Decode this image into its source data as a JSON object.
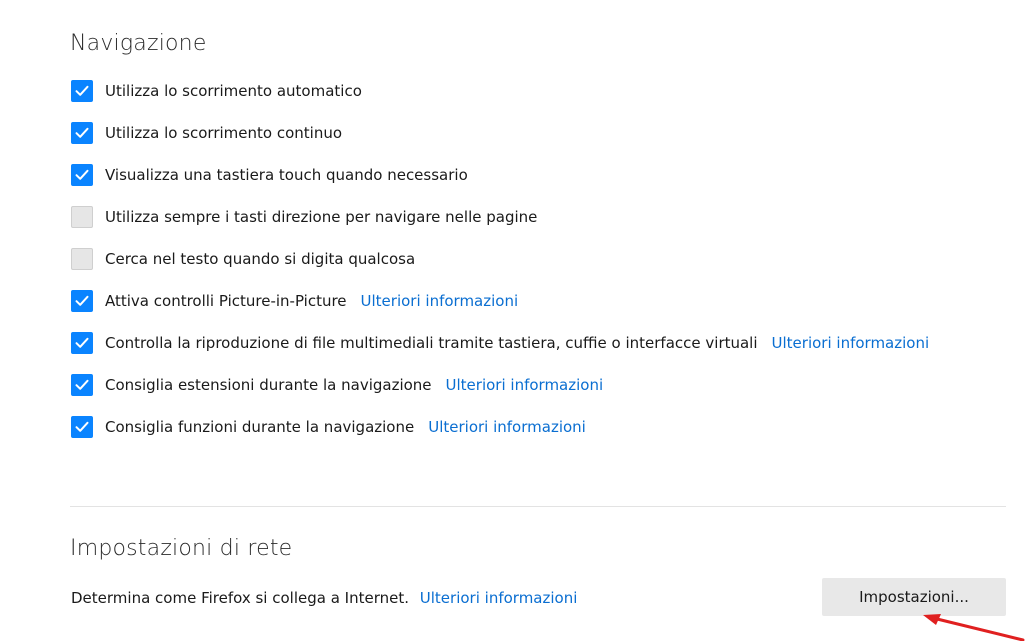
{
  "navigation": {
    "title": "Navigazione",
    "options": [
      {
        "label": "Utilizza lo scorrimento automatico",
        "checked": true,
        "link": ""
      },
      {
        "label": "Utilizza lo scorrimento continuo",
        "checked": true,
        "link": ""
      },
      {
        "label": "Visualizza una tastiera touch quando necessario",
        "checked": true,
        "link": ""
      },
      {
        "label": "Utilizza sempre i tasti direzione per navigare nelle pagine",
        "checked": false,
        "link": ""
      },
      {
        "label": "Cerca nel testo quando si digita qualcosa",
        "checked": false,
        "link": ""
      },
      {
        "label": "Attiva controlli Picture-in-Picture",
        "checked": true,
        "link": "Ulteriori informazioni"
      },
      {
        "label": "Controlla la riproduzione di file multimediali tramite tastiera, cuffie o interfacce virtuali",
        "checked": true,
        "link": "Ulteriori informazioni"
      },
      {
        "label": "Consiglia estensioni durante la navigazione",
        "checked": true,
        "link": "Ulteriori informazioni"
      },
      {
        "label": "Consiglia funzioni durante la navigazione",
        "checked": true,
        "link": "Ulteriori informazioni"
      }
    ]
  },
  "network": {
    "title": "Impostazioni di rete",
    "description": "Determina come Firefox si collega a Internet.",
    "link": "Ulteriori informazioni",
    "button_label": "Impostazioni..."
  },
  "colors": {
    "checkbox_checked": "#0a84ff",
    "link": "#0a6ed1",
    "annotation_arrow": "#e02020"
  }
}
